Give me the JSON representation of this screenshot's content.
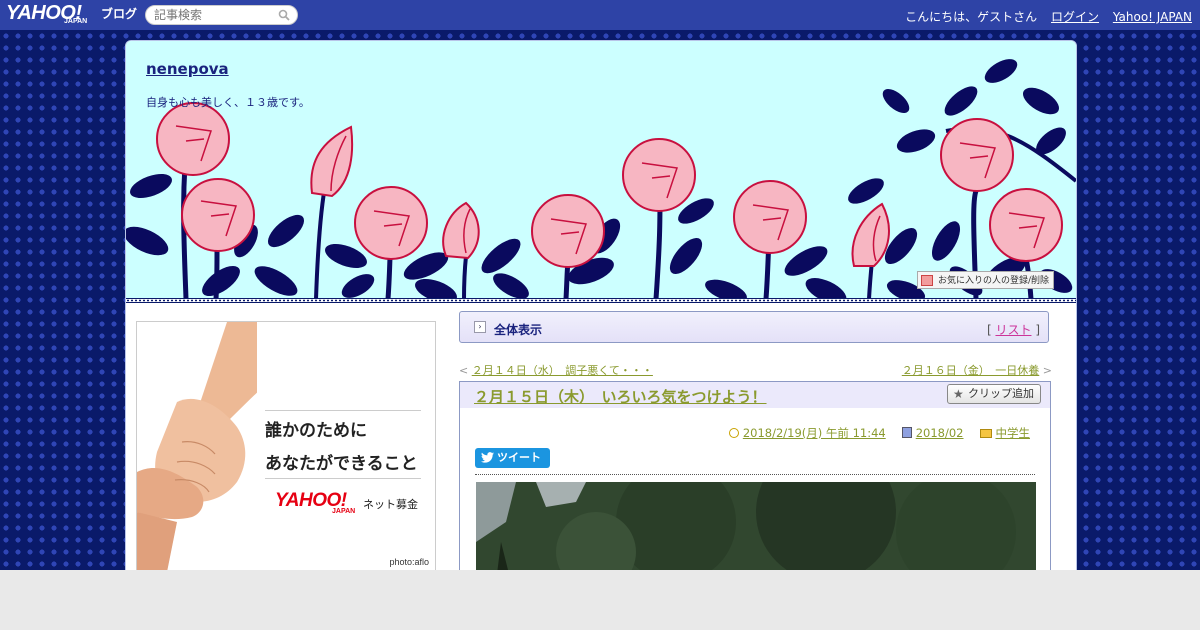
{
  "topbar": {
    "logo": "YAHOO!",
    "logo_sub": "JAPAN",
    "logo_suffix": "ブログ",
    "search_placeholder": "記事検索",
    "greeting": "こんにちは、ゲストさん",
    "login": "ログイン",
    "yahoo_japan": "Yahoo! JAPAN"
  },
  "header": {
    "title": "nenepova",
    "description": "自身も心も美しく、１３歳です。",
    "favorite_button": "お気に入りの人の登録/削除"
  },
  "ad": {
    "line1": "誰かのために",
    "line2": "あなたができること",
    "logo": "YAHOO!",
    "logo_sub": "JAPAN",
    "label": "ネット募金",
    "credit": "photo:aflo"
  },
  "view_bar": {
    "label": "全体表示",
    "list_open": "[",
    "list_link": "リスト",
    "list_close": "]"
  },
  "navigation": {
    "prev_arrow": "<",
    "prev_label": "２月１４日（水）　調子悪くて・・・",
    "next_label": "２月１６日（金）　一日休養",
    "next_arrow": ">"
  },
  "post": {
    "title": "２月１５日（木）　いろいろ気をつけよう！",
    "clip_button": "クリップ追加",
    "datetime": "2018/2/19(月) 午前 11:44",
    "archive": "2018/02",
    "category": "中学生",
    "tweet": "ツイート"
  },
  "colors": {
    "topbar": "#2e43a6",
    "background": "#0a1a6a",
    "header_bg": "#ccffff",
    "link_olive": "#8a9a2e",
    "link_pink": "#cc3399"
  }
}
